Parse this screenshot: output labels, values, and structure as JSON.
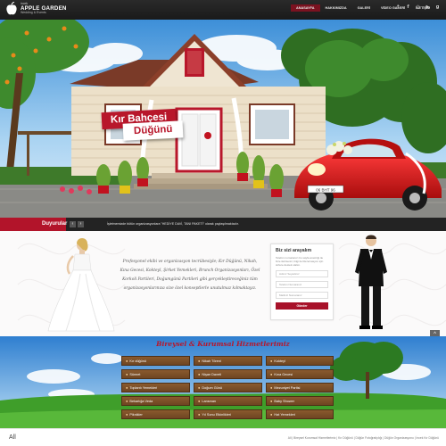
{
  "header": {
    "logo": {
      "small": "incek",
      "name": "APPLE GARDEN",
      "sub": "Wedding & Events"
    },
    "nav": [
      {
        "label": "ANASAYFA",
        "active": true
      },
      {
        "label": "HAKKIMIZDA",
        "active": false
      },
      {
        "label": "GALERİ",
        "active": false
      },
      {
        "label": "VİDEO GALERİ",
        "active": false
      },
      {
        "label": "İLETİŞİM",
        "active": false
      }
    ],
    "social_icons": [
      "twitter-icon",
      "facebook-icon",
      "instagram-icon",
      "youtube-icon",
      "google-plus-icon"
    ]
  },
  "hero": {
    "ribbon_line1": "Kır Bahçesi",
    "ribbon_line2": "Düğünü",
    "car_plate": "06 BHT 96"
  },
  "announcements": {
    "label": "Duyurular",
    "prev": "‹",
    "next": "›",
    "text": "İşletmemizde bütün organizasyonlara \"HEDİYE DAVİ, TANI PAKETİ\" olarak paylaşılmaktadır."
  },
  "intro": {
    "text": "Profesyonel ekibi ve organizasyon tecrübesiyle; Kır Düğünü, Nikah, Kına Gecesi, Kokteyl, Şirket Yemekleri, Brunch Organizasyonları, Özel Korkoli Partileri, Doğumgünü Partileri gibi gerçekleştireceğiniz tüm organizasyonlarınıza size özel konseptlerle unutulmaz kılmaktayız."
  },
  "contact_form": {
    "title": "Biz sizi arayalım",
    "description": "Telefon numaranızı bu sayfa aracılığı ile bize iletirseniz, bilgi ile Rezervasyon için sizlere destek olalım.",
    "fields": [
      {
        "placeholder": "Adınız Soyadınız"
      },
      {
        "placeholder": "Telefon Numaranız"
      },
      {
        "placeholder": "Mailiniz Numaranız"
      }
    ],
    "submit_label": "Gönder"
  },
  "services": {
    "title": "Bireysel & Kurumsal Hizmetlerimiz",
    "items": [
      "Kır düğünü",
      "Nikah Töreni",
      "Kokteyl",
      "Sünnet",
      "Nişan Daveti",
      "Kına Gecesi",
      "Toplantı Yemekleri",
      "Doğum Günü",
      "Mezuniyet Partisi",
      "Bekarlığa Veda",
      "Lansman",
      "Baby Shower",
      "Piknikler",
      "Yıl Sonu Etkinlikleri",
      "Hat Yemekleri"
    ]
  },
  "scroll_top": "^",
  "footer": {
    "left": "All",
    "breadcrumb": "All | Bireysel Kurumsal Hizmetlerimiz | Kır Düğünü | Düğün Fotoğrafçılığı | Düğün Organizasyonu | İncek Kır Düğünü"
  },
  "colors": {
    "brand_red": "#b8172b",
    "header_bg": "#1f1f1f",
    "service_wood": "#7a4c27"
  }
}
